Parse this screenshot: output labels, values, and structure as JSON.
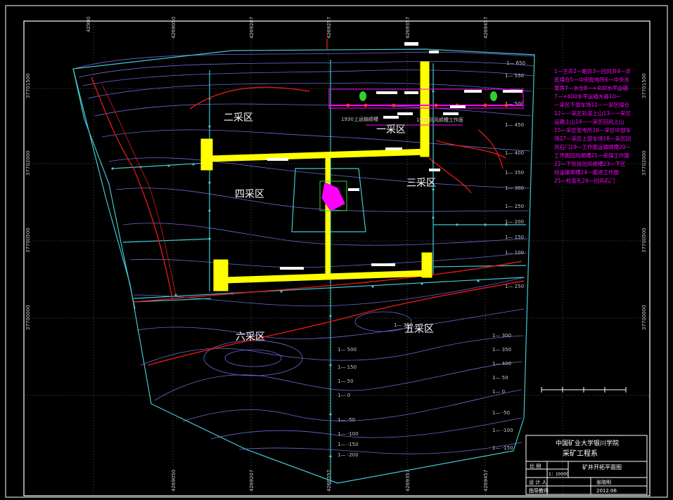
{
  "drawing": {
    "zones": [
      {
        "id": "zone-1",
        "label": "一采区"
      },
      {
        "id": "zone-2",
        "label": "二采区"
      },
      {
        "id": "zone-3",
        "label": "三采区"
      },
      {
        "id": "zone-4",
        "label": "四采区"
      },
      {
        "id": "zone-5",
        "label": "五采区"
      },
      {
        "id": "zone-6",
        "label": "六采区"
      }
    ],
    "legend_lines": [
      "1—主井2—副井3—回风井4—井",
      "底煤仓5—中央配电所6—中央水",
      "泵房7—水仓8—+400水平运输",
      "7—+400水平运输大巷10—",
      "一采区下部车场11—一采区煤仓",
      "12—一采区轨道上山13—一采区",
      "运输上山14—一采区回风上山",
      "15—采区变电所16—采区中部车",
      "场17—采区上部车场18—采区回",
      "风石门19—工作面运输顺槽20—",
      "工作面回风顺槽21—采煤工作面",
      "22—下区段回风顺槽23—下区",
      "段运输顺槽24—掘进工作面",
      "25—检查孔26—回风石门"
    ],
    "contour_labels": [
      "1— 650",
      "1— 600",
      "1— 550",
      "1— 500",
      "1— 450",
      "1— 400",
      "1— 350",
      "1— 300",
      "1— 250",
      "1— 200",
      "1— 150",
      "1— 100",
      "1— 50",
      "1— 0",
      "1— -50",
      "1— -100",
      "1— -150",
      "1— -200",
      "1— -250"
    ],
    "top_coords": [
      "42900",
      "4269050",
      "4269207",
      "4269257",
      "4269357",
      "4269457"
    ],
    "side_coords": [
      "37701500",
      "37702000",
      "37700500",
      "37700000"
    ],
    "face_labels": [
      "1930上运输顺槽",
      "1930回风顺槽工作面"
    ]
  },
  "title_block": {
    "school": "中国矿业大学银川学院",
    "department": "采矿工程系",
    "scale_label": "比 例",
    "scale_value": "1：10000",
    "drawing_title": "矿井开拓平面图",
    "designer_label": "设 计 人",
    "reviewer_label": "指导教师",
    "designer_value": "张晓明",
    "date_value": "2012.06"
  },
  "colors": {
    "background": "#000000",
    "contour": "#6a6ad8",
    "boundary": "#40c8d0",
    "roadway": "#ffff00",
    "fault": "#e01818",
    "legend": "#ff00ff",
    "frame": "#ffffff"
  }
}
